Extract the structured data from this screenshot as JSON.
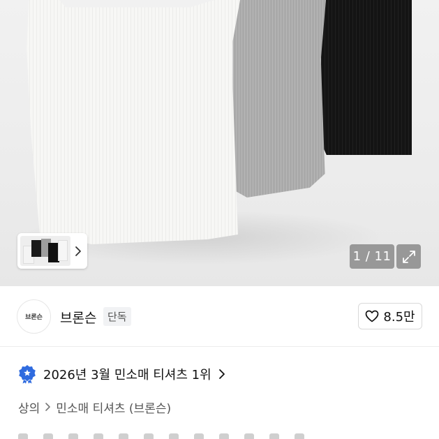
{
  "gallery": {
    "counter": "1 / 11"
  },
  "brand": {
    "logo_text": "브론슨",
    "name": "브론슨",
    "badge": "단독"
  },
  "like": {
    "count": "8.5만"
  },
  "ranking": {
    "text": "2026년 3월 민소매 티셔츠 1위"
  },
  "breadcrumb": {
    "items": [
      "상의",
      "민소매 티셔츠 (브론슨)"
    ]
  },
  "colors": {
    "rank_badge": "#2f6bdf",
    "overlay": "#787878"
  }
}
